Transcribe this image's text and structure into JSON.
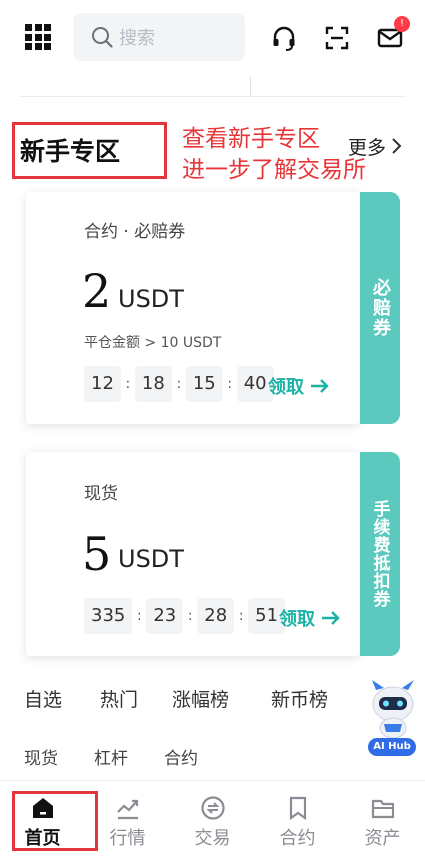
{
  "header": {
    "search_placeholder": "搜索",
    "notification_badge": "!"
  },
  "section": {
    "title": "新手专区",
    "annotation_line1": "查看新手专区",
    "annotation_line2": "进一步了解交易所",
    "more_label": "更多"
  },
  "cards": [
    {
      "label": "合约 · 必赔券",
      "amount": "2",
      "unit": "USDT",
      "note": "平仓金额 > 10 USDT",
      "timer": [
        "12",
        "18",
        "15",
        "40"
      ],
      "claim_label": "领取",
      "tab_label": "必赔券"
    },
    {
      "label": "现货",
      "amount": "5",
      "unit": "USDT",
      "note": "",
      "timer": [
        "335",
        "23",
        "28",
        "51"
      ],
      "claim_label": "领取",
      "tab_label": "手续费抵扣券"
    }
  ],
  "category_tabs": [
    "自选",
    "热门",
    "涨幅榜",
    "新币榜"
  ],
  "sub_tabs": [
    "现货",
    "杠杆",
    "合约"
  ],
  "ai_hub": {
    "label": "AI Hub"
  },
  "bottom_nav": [
    {
      "label": "首页",
      "icon": "home-icon",
      "active": true
    },
    {
      "label": "行情",
      "icon": "chart-icon",
      "active": false
    },
    {
      "label": "交易",
      "icon": "trade-icon",
      "active": false
    },
    {
      "label": "合约",
      "icon": "contract-icon",
      "active": false
    },
    {
      "label": "资产",
      "icon": "wallet-icon",
      "active": false
    }
  ],
  "colors": {
    "accent": "#5cc9bf",
    "claim": "#1ab3a6",
    "annotation": "#e8353a",
    "badge": "#ff3b47"
  }
}
